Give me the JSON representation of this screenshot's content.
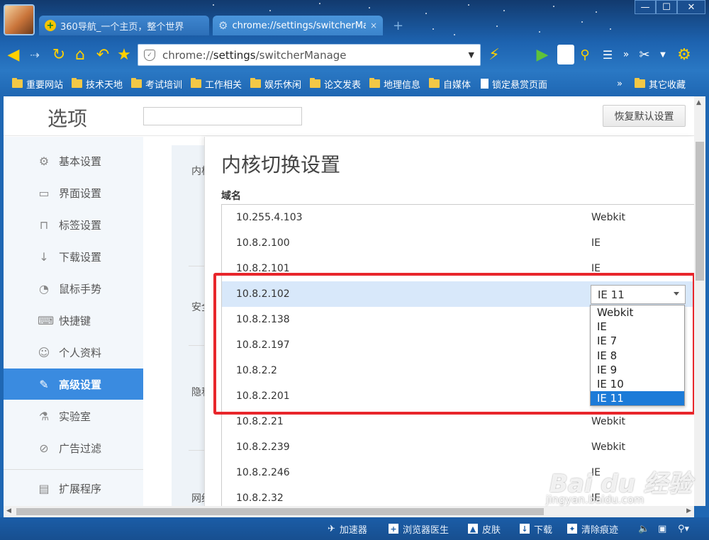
{
  "tabs": [
    {
      "label": "360导航_一个主页，整个世界",
      "icon": "360-nav-icon"
    },
    {
      "label": "chrome://settings/switcherManage",
      "icon": "gear-icon",
      "close": "×"
    }
  ],
  "newtab_symbol": "+",
  "window_controls": [
    "—",
    "☐",
    "✕"
  ],
  "address_bar": {
    "prefix": "chrome://",
    "host": "settings",
    "path": "/switcherManage"
  },
  "bookmarks": [
    {
      "label": "重要网站",
      "type": "folder"
    },
    {
      "label": "技术天地",
      "type": "folder"
    },
    {
      "label": "考试培训",
      "type": "folder"
    },
    {
      "label": "工作相关",
      "type": "folder"
    },
    {
      "label": "娱乐休闲",
      "type": "folder"
    },
    {
      "label": "论文发表",
      "type": "folder"
    },
    {
      "label": "地理信息",
      "type": "folder"
    },
    {
      "label": "自媒体",
      "type": "folder"
    },
    {
      "label": "锁定悬赏页面",
      "type": "page"
    },
    {
      "label": "其它收藏",
      "type": "folder"
    }
  ],
  "bookmarks_more": "»",
  "settings": {
    "title": "选项",
    "search_placeholder": "",
    "reset_label": "恢复默认设置"
  },
  "sidebar": [
    {
      "label": "基本设置",
      "icon": "gear-icon",
      "glyph": "⚙"
    },
    {
      "label": "界面设置",
      "icon": "window-icon",
      "glyph": "▭"
    },
    {
      "label": "标签设置",
      "icon": "tab-icon",
      "glyph": "⊓"
    },
    {
      "label": "下载设置",
      "icon": "download-icon",
      "glyph": "↓"
    },
    {
      "label": "鼠标手势",
      "icon": "mouse-icon",
      "glyph": "◔"
    },
    {
      "label": "快捷键",
      "icon": "shortcut-icon",
      "glyph": "⌨"
    },
    {
      "label": "个人资料",
      "icon": "user-icon",
      "glyph": "☺"
    },
    {
      "label": "高级设置",
      "icon": "wrench-icon",
      "glyph": "✎",
      "active": true
    },
    {
      "label": "实验室",
      "icon": "flask-icon",
      "glyph": "⚗"
    },
    {
      "label": "广告过滤",
      "icon": "block-icon",
      "glyph": "⊘"
    },
    {
      "label": "扩展程序",
      "icon": "extension-icon",
      "glyph": "▤"
    }
  ],
  "behind_labels": [
    "内核",
    "安全",
    "隐私",
    "网络"
  ],
  "switcher": {
    "title": "内核切换设置",
    "column_header": "域名",
    "rows": [
      {
        "domain": "10.255.4.103",
        "kernel": "Webkit"
      },
      {
        "domain": "10.8.2.100",
        "kernel": "IE"
      },
      {
        "domain": "10.8.2.101",
        "kernel": "IE"
      },
      {
        "domain": "10.8.2.102",
        "kernel": "IE 11",
        "selected": true
      },
      {
        "domain": "10.8.2.138",
        "kernel": ""
      },
      {
        "domain": "10.8.2.197",
        "kernel": ""
      },
      {
        "domain": "10.8.2.2",
        "kernel": ""
      },
      {
        "domain": "10.8.2.201",
        "kernel": ""
      },
      {
        "domain": "10.8.2.21",
        "kernel": "Webkit"
      },
      {
        "domain": "10.8.2.239",
        "kernel": "Webkit"
      },
      {
        "domain": "10.8.2.246",
        "kernel": "IE"
      },
      {
        "domain": "10.8.2.32",
        "kernel": "IE"
      }
    ],
    "dropdown_options": [
      "Webkit",
      "IE",
      "IE 7",
      "IE 8",
      "IE 9",
      "IE 10",
      "IE 11"
    ],
    "dropdown_selected": "IE 11"
  },
  "statusbar": [
    {
      "label": "加速器",
      "icon": "rocket-icon"
    },
    {
      "label": "浏览器医生",
      "icon": "doctor-icon"
    },
    {
      "label": "皮肤",
      "icon": "skin-icon"
    },
    {
      "label": "下载",
      "icon": "download-icon"
    },
    {
      "label": "清除痕迹",
      "icon": "broom-icon"
    }
  ],
  "watermark": {
    "logo": "Bai du 经验",
    "url": "jingyan.baidu.com"
  },
  "colors": {
    "accent": "#3a8be0",
    "highlight": "#e8262b",
    "frame": "#1e5fa8"
  }
}
